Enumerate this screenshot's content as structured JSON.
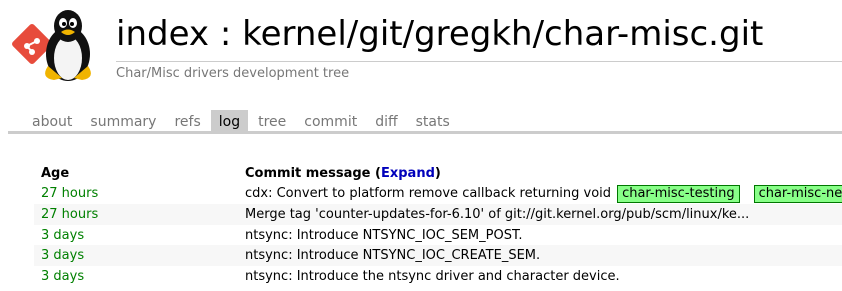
{
  "header": {
    "title": "index : kernel/git/gregkh/char-misc.git",
    "subtitle": "Char/Misc drivers development tree"
  },
  "tabs": [
    {
      "label": "about",
      "active": false
    },
    {
      "label": "summary",
      "active": false
    },
    {
      "label": "refs",
      "active": false
    },
    {
      "label": "log",
      "active": true
    },
    {
      "label": "tree",
      "active": false
    },
    {
      "label": "commit",
      "active": false
    },
    {
      "label": "diff",
      "active": false
    },
    {
      "label": "stats",
      "active": false
    }
  ],
  "table": {
    "age_header": "Age",
    "message_header": "Commit message (",
    "expand_label": "Expand",
    "message_header_close": ")",
    "rows": [
      {
        "age": "27 hours",
        "message": "cdx: Convert to platform remove callback returning void",
        "decorations": [
          "char-misc-testing",
          "char-misc-next"
        ]
      },
      {
        "age": "27 hours",
        "message": "Merge tag 'counter-updates-for-6.10' of git://git.kernel.org/pub/scm/linux/ke...",
        "decorations": []
      },
      {
        "age": "3 days",
        "message": "ntsync: Introduce NTSYNC_IOC_SEM_POST.",
        "decorations": []
      },
      {
        "age": "3 days",
        "message": "ntsync: Introduce NTSYNC_IOC_CREATE_SEM.",
        "decorations": []
      },
      {
        "age": "3 days",
        "message": "ntsync: Introduce the ntsync driver and character device.",
        "decorations": []
      }
    ]
  },
  "colors": {
    "age_green": "#008000",
    "decoration_bg": "#88ff88",
    "decoration_border": "#007700",
    "link_blue": "#0000bb",
    "logo_red": "#e74c3c"
  }
}
